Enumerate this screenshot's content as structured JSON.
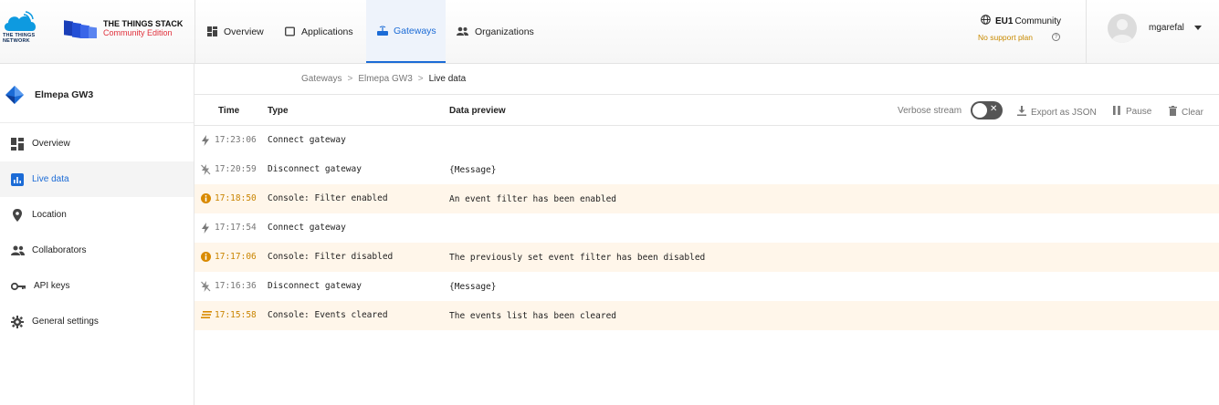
{
  "brand": {
    "ttn_text_line1": "THE THINGS",
    "ttn_text_line2": "NETWORK",
    "stack_title": "THE THINGS STACK",
    "stack_edition": "Community Edition"
  },
  "nav": {
    "items": [
      {
        "label": "Overview",
        "icon": "dashboard-icon"
      },
      {
        "label": "Applications",
        "icon": "applications-icon"
      },
      {
        "label": "Gateways",
        "icon": "gateway-icon",
        "active": true
      },
      {
        "label": "Organizations",
        "icon": "organizations-icon"
      }
    ]
  },
  "cluster": {
    "name": "EU1",
    "label": "Community",
    "support": "No support plan"
  },
  "user": {
    "name": "mgarefal"
  },
  "sidebar": {
    "gateway_name": "Elmepa GW3",
    "items": [
      {
        "label": "Overview",
        "icon": "dashboard-icon"
      },
      {
        "label": "Live data",
        "icon": "chart-icon",
        "active": true
      },
      {
        "label": "Location",
        "icon": "location-pin-icon"
      },
      {
        "label": "Collaborators",
        "icon": "people-icon"
      },
      {
        "label": "API keys",
        "icon": "key-icon"
      },
      {
        "label": "General settings",
        "icon": "gear-icon"
      }
    ]
  },
  "breadcrumb": {
    "items": [
      "Gateways",
      "Elmepa GW3",
      "Live data"
    ]
  },
  "table": {
    "headers": {
      "time": "Time",
      "type": "Type",
      "preview": "Data preview"
    },
    "tools": {
      "verbose": "Verbose stream",
      "export": "Export as JSON",
      "pause": "Pause",
      "clear": "Clear"
    },
    "rows": [
      {
        "time": "17:23:06",
        "type": "Connect gateway",
        "preview": "",
        "icon": "bolt-icon",
        "warn": false
      },
      {
        "time": "17:20:59",
        "type": "Disconnect gateway",
        "preview": "{Message}",
        "icon": "bolt-off-icon",
        "warn": false
      },
      {
        "time": "17:18:50",
        "type": "Console: Filter enabled",
        "preview": "An event filter has been enabled",
        "icon": "info-icon",
        "warn": true
      },
      {
        "time": "17:17:54",
        "type": "Connect gateway",
        "preview": "",
        "icon": "bolt-icon",
        "warn": false
      },
      {
        "time": "17:17:06",
        "type": "Console: Filter disabled",
        "preview": "The previously set event filter has been disabled",
        "icon": "info-icon",
        "warn": true
      },
      {
        "time": "17:16:36",
        "type": "Disconnect gateway",
        "preview": "{Message}",
        "icon": "bolt-off-icon",
        "warn": false
      },
      {
        "time": "17:15:58",
        "type": "Console: Events cleared",
        "preview": "The events list has been cleared",
        "icon": "clear-all-icon",
        "warn": true
      }
    ]
  },
  "colors": {
    "accent": "#1b6bd6",
    "warning": "#c98400",
    "warn_row_bg": "#fff6ea",
    "brand_red": "#e0303b"
  }
}
